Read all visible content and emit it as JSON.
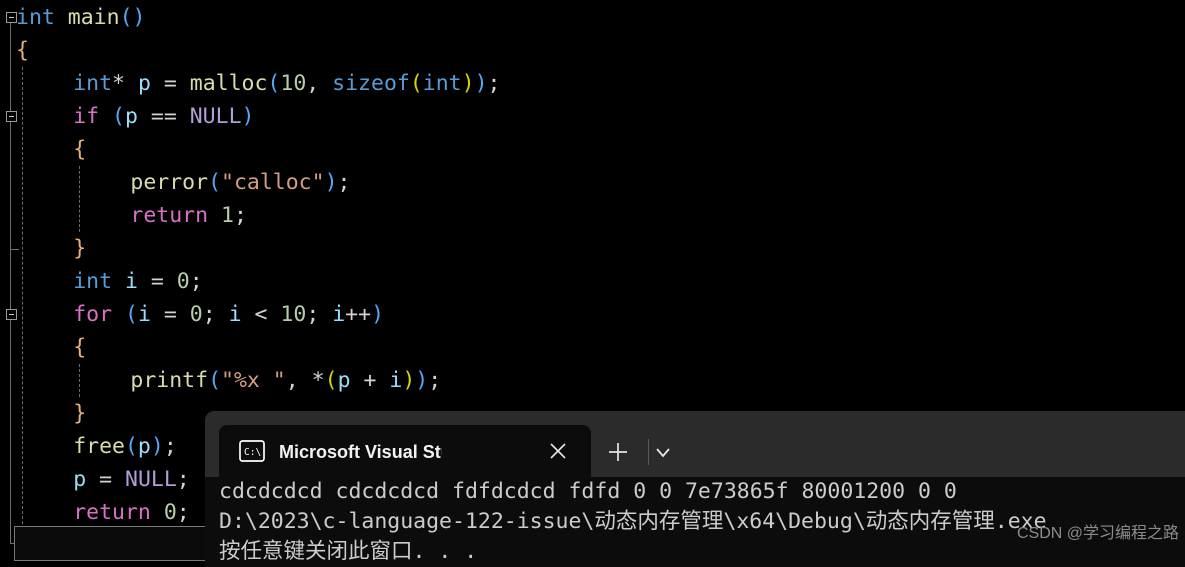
{
  "editor": {
    "background": "#000000",
    "lines": [
      {
        "indent": 0,
        "tokens": [
          {
            "t": "int",
            "c": "kw"
          },
          {
            "t": " ",
            "c": "punct"
          },
          {
            "t": "main",
            "c": "fn"
          },
          {
            "t": "(",
            "c": "paren1"
          },
          {
            "t": ")",
            "c": "paren1"
          }
        ]
      },
      {
        "indent": 0,
        "tokens": [
          {
            "t": "{",
            "c": "brace"
          }
        ]
      },
      {
        "indent": 1,
        "tokens": [
          {
            "t": "int",
            "c": "kw"
          },
          {
            "t": "*",
            "c": "op"
          },
          {
            "t": " ",
            "c": "punct"
          },
          {
            "t": "p",
            "c": "var"
          },
          {
            "t": " ",
            "c": "punct"
          },
          {
            "t": "=",
            "c": "op"
          },
          {
            "t": " ",
            "c": "punct"
          },
          {
            "t": "malloc",
            "c": "fn"
          },
          {
            "t": "(",
            "c": "paren1"
          },
          {
            "t": "10",
            "c": "num"
          },
          {
            "t": ",",
            "c": "punct"
          },
          {
            "t": " ",
            "c": "punct"
          },
          {
            "t": "sizeof",
            "c": "kw"
          },
          {
            "t": "(",
            "c": "paren2"
          },
          {
            "t": "int",
            "c": "kw"
          },
          {
            "t": ")",
            "c": "paren2"
          },
          {
            "t": ")",
            "c": "paren1"
          },
          {
            "t": ";",
            "c": "punct"
          }
        ]
      },
      {
        "indent": 1,
        "tokens": [
          {
            "t": "if",
            "c": "ctl"
          },
          {
            "t": " ",
            "c": "punct"
          },
          {
            "t": "(",
            "c": "paren1"
          },
          {
            "t": "p",
            "c": "var"
          },
          {
            "t": " ",
            "c": "punct"
          },
          {
            "t": "==",
            "c": "op"
          },
          {
            "t": " ",
            "c": "punct"
          },
          {
            "t": "NULL",
            "c": "macro"
          },
          {
            "t": ")",
            "c": "paren1"
          }
        ]
      },
      {
        "indent": 1,
        "tokens": [
          {
            "t": "{",
            "c": "brace"
          }
        ]
      },
      {
        "indent": 2,
        "tokens": [
          {
            "t": "perror",
            "c": "fn"
          },
          {
            "t": "(",
            "c": "paren1"
          },
          {
            "t": "\"calloc\"",
            "c": "str"
          },
          {
            "t": ")",
            "c": "paren1"
          },
          {
            "t": ";",
            "c": "punct"
          }
        ]
      },
      {
        "indent": 2,
        "tokens": [
          {
            "t": "return",
            "c": "ctl"
          },
          {
            "t": " ",
            "c": "punct"
          },
          {
            "t": "1",
            "c": "num"
          },
          {
            "t": ";",
            "c": "punct"
          }
        ]
      },
      {
        "indent": 1,
        "tokens": [
          {
            "t": "}",
            "c": "brace"
          }
        ]
      },
      {
        "indent": 1,
        "tokens": [
          {
            "t": "int",
            "c": "kw"
          },
          {
            "t": " ",
            "c": "punct"
          },
          {
            "t": "i",
            "c": "var"
          },
          {
            "t": " ",
            "c": "punct"
          },
          {
            "t": "=",
            "c": "op"
          },
          {
            "t": " ",
            "c": "punct"
          },
          {
            "t": "0",
            "c": "num"
          },
          {
            "t": ";",
            "c": "punct"
          }
        ]
      },
      {
        "indent": 1,
        "tokens": [
          {
            "t": "for",
            "c": "ctl"
          },
          {
            "t": " ",
            "c": "punct"
          },
          {
            "t": "(",
            "c": "paren1"
          },
          {
            "t": "i",
            "c": "var"
          },
          {
            "t": " ",
            "c": "punct"
          },
          {
            "t": "=",
            "c": "op"
          },
          {
            "t": " ",
            "c": "punct"
          },
          {
            "t": "0",
            "c": "num"
          },
          {
            "t": ";",
            "c": "punct"
          },
          {
            "t": " ",
            "c": "punct"
          },
          {
            "t": "i",
            "c": "var"
          },
          {
            "t": " ",
            "c": "punct"
          },
          {
            "t": "<",
            "c": "op"
          },
          {
            "t": " ",
            "c": "punct"
          },
          {
            "t": "10",
            "c": "num"
          },
          {
            "t": ";",
            "c": "punct"
          },
          {
            "t": " ",
            "c": "punct"
          },
          {
            "t": "i",
            "c": "var"
          },
          {
            "t": "++",
            "c": "op"
          },
          {
            "t": ")",
            "c": "paren1"
          }
        ]
      },
      {
        "indent": 1,
        "tokens": [
          {
            "t": "{",
            "c": "brace"
          }
        ]
      },
      {
        "indent": 2,
        "tokens": [
          {
            "t": "printf",
            "c": "fn"
          },
          {
            "t": "(",
            "c": "paren1"
          },
          {
            "t": "\"%x \"",
            "c": "str"
          },
          {
            "t": ",",
            "c": "punct"
          },
          {
            "t": " ",
            "c": "punct"
          },
          {
            "t": "*",
            "c": "op"
          },
          {
            "t": "(",
            "c": "paren2"
          },
          {
            "t": "p",
            "c": "var"
          },
          {
            "t": " ",
            "c": "punct"
          },
          {
            "t": "+",
            "c": "op"
          },
          {
            "t": " ",
            "c": "punct"
          },
          {
            "t": "i",
            "c": "var"
          },
          {
            "t": ")",
            "c": "paren2"
          },
          {
            "t": ")",
            "c": "paren1"
          },
          {
            "t": ";",
            "c": "punct"
          }
        ]
      },
      {
        "indent": 1,
        "tokens": [
          {
            "t": "}",
            "c": "brace"
          }
        ]
      },
      {
        "indent": 1,
        "tokens": [
          {
            "t": "free",
            "c": "fn"
          },
          {
            "t": "(",
            "c": "paren1"
          },
          {
            "t": "p",
            "c": "var"
          },
          {
            "t": ")",
            "c": "paren1"
          },
          {
            "t": ";",
            "c": "punct"
          }
        ]
      },
      {
        "indent": 1,
        "tokens": [
          {
            "t": "p",
            "c": "var"
          },
          {
            "t": " ",
            "c": "punct"
          },
          {
            "t": "=",
            "c": "op"
          },
          {
            "t": " ",
            "c": "punct"
          },
          {
            "t": "NULL",
            "c": "macro"
          },
          {
            "t": ";",
            "c": "punct"
          }
        ]
      },
      {
        "indent": 1,
        "tokens": [
          {
            "t": "return",
            "c": "ctl"
          },
          {
            "t": " ",
            "c": "punct"
          },
          {
            "t": "0",
            "c": "num"
          },
          {
            "t": ";",
            "c": "punct"
          }
        ]
      },
      {
        "indent": 0,
        "tokens": [
          {
            "t": "}",
            "c": "brace"
          }
        ]
      }
    ],
    "fold_markers": [
      0,
      3,
      9
    ],
    "highlighted_line": 16
  },
  "terminal": {
    "tab": {
      "title": "Microsoft Visual Studio 调试控",
      "icon": "console-cmd-icon",
      "close_label": "×"
    },
    "new_tab_label": "+",
    "dropdown_label": "⌄",
    "output_lines": [
      "cdcdcdcd cdcdcdcd fdfdcdcd fdfd 0 0 7e73865f 80001200 0 0",
      "D:\\2023\\c-language-122-issue\\动态内存管理\\x64\\Debug\\动态内存管理.exe",
      "按任意键关闭此窗口. . ."
    ],
    "titlebar_color": "#2b2b2b",
    "body_color": "#0c0c0c"
  },
  "watermark": {
    "text": "CSDN @学习编程之路"
  }
}
